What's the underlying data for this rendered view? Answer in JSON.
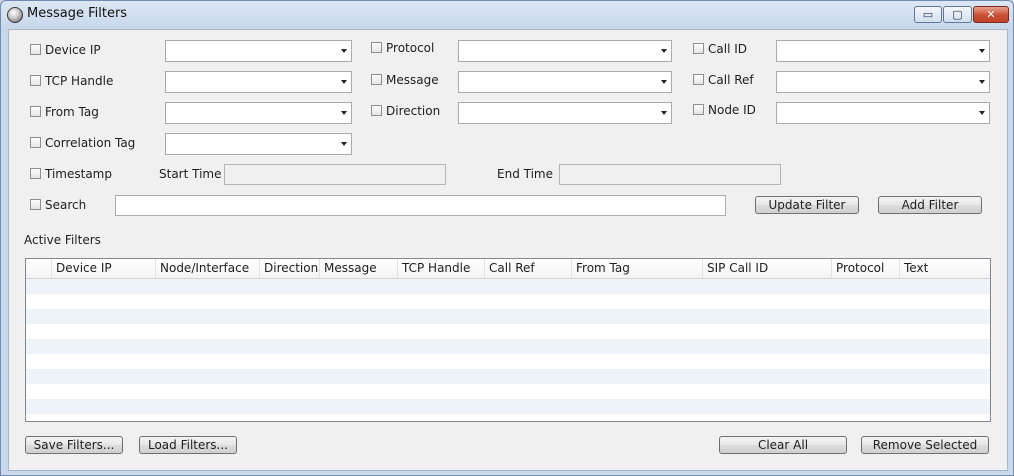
{
  "window": {
    "title": "Message Filters",
    "controls": {
      "minimize": "▭",
      "maximize": "▢",
      "close": "✕"
    }
  },
  "filters": {
    "device_ip": "Device IP",
    "tcp_handle": "TCP Handle",
    "from_tag": "From Tag",
    "correlation_tag": "Correlation Tag",
    "protocol": "Protocol",
    "message": "Message",
    "direction": "Direction",
    "call_id": "Call ID",
    "call_ref": "Call Ref",
    "node_id": "Node ID",
    "timestamp": "Timestamp",
    "start_time": "Start Time",
    "end_time": "End Time",
    "search": "Search"
  },
  "buttons": {
    "update_filter": "Update Filter",
    "add_filter": "Add Filter",
    "save_filters": "Save Filters...",
    "load_filters": "Load Filters...",
    "clear_all": "Clear All",
    "remove_selected": "Remove Selected"
  },
  "active_filters": {
    "label": "Active Filters",
    "columns": [
      "Device IP",
      "Node/Interface",
      "Direction",
      "Message",
      "TCP Handle",
      "Call Ref",
      "From Tag",
      "SIP Call ID",
      "Protocol",
      "Text"
    ],
    "rows": []
  }
}
